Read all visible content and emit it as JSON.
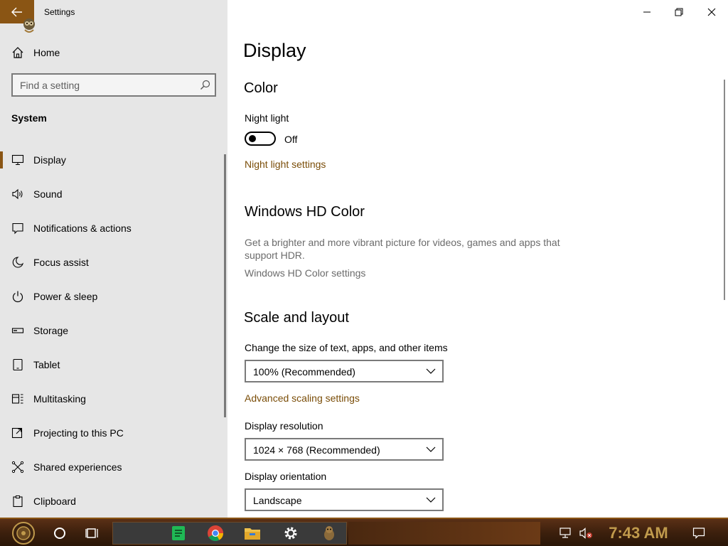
{
  "window": {
    "app_title": "Settings",
    "controls": [
      "minimize",
      "maximize",
      "close"
    ]
  },
  "sidebar": {
    "home_label": "Home",
    "search_placeholder": "Find a setting",
    "section_label": "System",
    "items": [
      {
        "label": "Display",
        "icon": "monitor-icon",
        "selected": true
      },
      {
        "label": "Sound",
        "icon": "speaker-icon",
        "selected": false
      },
      {
        "label": "Notifications & actions",
        "icon": "notification-icon",
        "selected": false
      },
      {
        "label": "Focus assist",
        "icon": "moon-icon",
        "selected": false
      },
      {
        "label": "Power & sleep",
        "icon": "power-icon",
        "selected": false
      },
      {
        "label": "Storage",
        "icon": "storage-icon",
        "selected": false
      },
      {
        "label": "Tablet",
        "icon": "tablet-icon",
        "selected": false
      },
      {
        "label": "Multitasking",
        "icon": "multitasking-icon",
        "selected": false
      },
      {
        "label": "Projecting to this PC",
        "icon": "projecting-icon",
        "selected": false
      },
      {
        "label": "Shared experiences",
        "icon": "shared-icon",
        "selected": false
      },
      {
        "label": "Clipboard",
        "icon": "clipboard-icon",
        "selected": false
      }
    ]
  },
  "main": {
    "page_title": "Display",
    "color": {
      "heading": "Color",
      "night_light_label": "Night light",
      "night_light_state": "Off",
      "night_light_settings_link": "Night light settings"
    },
    "hd_color": {
      "heading": "Windows HD Color",
      "description": "Get a brighter and more vibrant picture for videos, games and apps that support HDR.",
      "settings_link": "Windows HD Color settings"
    },
    "scale_layout": {
      "heading": "Scale and layout",
      "size_label": "Change the size of text, apps, and other items",
      "size_value": "100% (Recommended)",
      "advanced_link": "Advanced scaling settings",
      "resolution_label": "Display resolution",
      "resolution_value": "1024 × 768 (Recommended)",
      "orientation_label": "Display orientation",
      "orientation_value": "Landscape"
    }
  },
  "taskbar": {
    "clock": "7:43 AM",
    "pinned": [
      "spotify",
      "chrome",
      "file-explorer",
      "settings",
      "app-gopher"
    ]
  },
  "colors": {
    "accent": "#8a5514",
    "link": "#7a4d08",
    "sidebar_bg": "#e6e6e6",
    "clock": "#c09a4c"
  }
}
